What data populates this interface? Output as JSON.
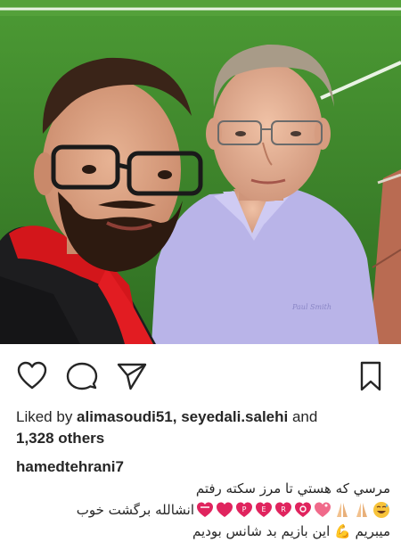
{
  "post": {
    "photo_alt": "Selfie of two men on a football pitch",
    "shirt_brand": "Paul Smith"
  },
  "actions": {
    "like_icon": "heart-icon",
    "comment_icon": "comment-icon",
    "share_icon": "paper-plane-icon",
    "save_icon": "bookmark-icon"
  },
  "likes": {
    "prefix": "Liked by ",
    "user1": "alimasoudi51",
    "separator": ", ",
    "user2": "seyedali.salehi",
    "conj": " and",
    "others": "1,328 others"
  },
  "caption": {
    "username": "hamedtehrani7",
    "line1": "مرسي كه هستي تا مرز سكته رفتم",
    "line2_text": "انشالله برگشت خوب",
    "line3": "میبریم 💪 این بازیم بد شانس بودیم"
  },
  "colors": {
    "grass": "#3f8a2c",
    "grass_dark": "#2f6e22",
    "jersey_red": "#d3161b",
    "shirt_lilac": "#b9b4e8",
    "text": "#262626"
  }
}
